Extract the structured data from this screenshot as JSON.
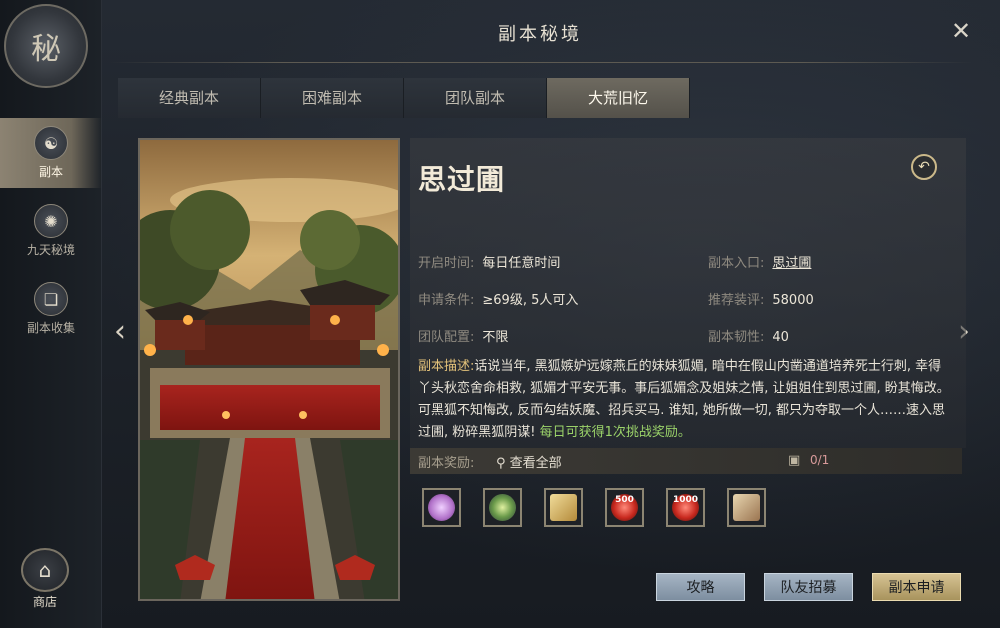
{
  "window": {
    "title": "副本秘境",
    "close_label": "✕"
  },
  "sidebar": {
    "logo_glyph": "秘",
    "items": [
      {
        "label": "副本",
        "icon": "mask-icon",
        "glyph": "☯",
        "active": true
      },
      {
        "label": "九天秘境",
        "icon": "swirl-icon",
        "glyph": "✺",
        "active": false
      },
      {
        "label": "副本收集",
        "icon": "book-icon",
        "glyph": "❏",
        "active": false
      }
    ],
    "shop": {
      "label": "商店",
      "icon": "shop-icon",
      "glyph": "⌂"
    }
  },
  "tabs": [
    {
      "label": "经典副本",
      "active": false
    },
    {
      "label": "困难副本",
      "active": false
    },
    {
      "label": "团队副本",
      "active": false
    },
    {
      "label": "大荒旧忆",
      "active": true
    }
  ],
  "nav": {
    "prev": "‹",
    "next": "›"
  },
  "dungeon": {
    "name": "思过圃",
    "back_glyph": "↶",
    "fields": {
      "open_time": {
        "label": "开启时间:",
        "value": "每日任意时间"
      },
      "entrance": {
        "label": "副本入口:",
        "value": "思过圃"
      },
      "requirement": {
        "label": "申请条件:",
        "value": "≥69级, 5人可入"
      },
      "recommend_gear": {
        "label": "推荐装评:",
        "value": "58000"
      },
      "team_config": {
        "label": "团队配置:",
        "value": "不限"
      },
      "toughness": {
        "label": "副本韧性:",
        "value": "40"
      }
    },
    "description_label": "副本描述:",
    "description": "话说当年, 黑狐嫉妒远嫁燕丘的妹妹狐媚, 暗中在假山内凿通道培养死士行刺, 幸得丫头秋恋舍命相救, 狐媚才平安无事。事后狐媚念及姐妹之情, 让姐姐住到思过圃, 盼其悔改。可黑狐不知悔改, 反而勾结妖魔、招兵买马. 谁知, 她所做一切, 都只为夺取一个人……速入思过圃, 粉碎黑狐阴谋! ",
    "description_highlight": "每日可获得1次挑战奖励。"
  },
  "rewards": {
    "label": "副本奖励:",
    "view_all": "查看全部",
    "search_glyph": "⚲",
    "chest_glyph": "▣",
    "count": "0/1",
    "items": [
      {
        "icon": "pink-feather-icon",
        "text": "",
        "color": "#c98ad6"
      },
      {
        "icon": "jade-orb-icon",
        "text": "",
        "color": "#7fb06a"
      },
      {
        "icon": "gold-scroll-icon",
        "text": "",
        "color": "#d2b45a"
      },
      {
        "icon": "red-token-500-icon",
        "text": "500",
        "color": "#d23a3a"
      },
      {
        "icon": "red-token-1000-icon",
        "text": "1000",
        "color": "#d23a3a"
      },
      {
        "icon": "paper-scroll-icon",
        "text": "",
        "color": "#b08a60"
      }
    ]
  },
  "buttons": {
    "guide": "攻略",
    "recruit": "队友招募",
    "apply": "副本申请"
  }
}
